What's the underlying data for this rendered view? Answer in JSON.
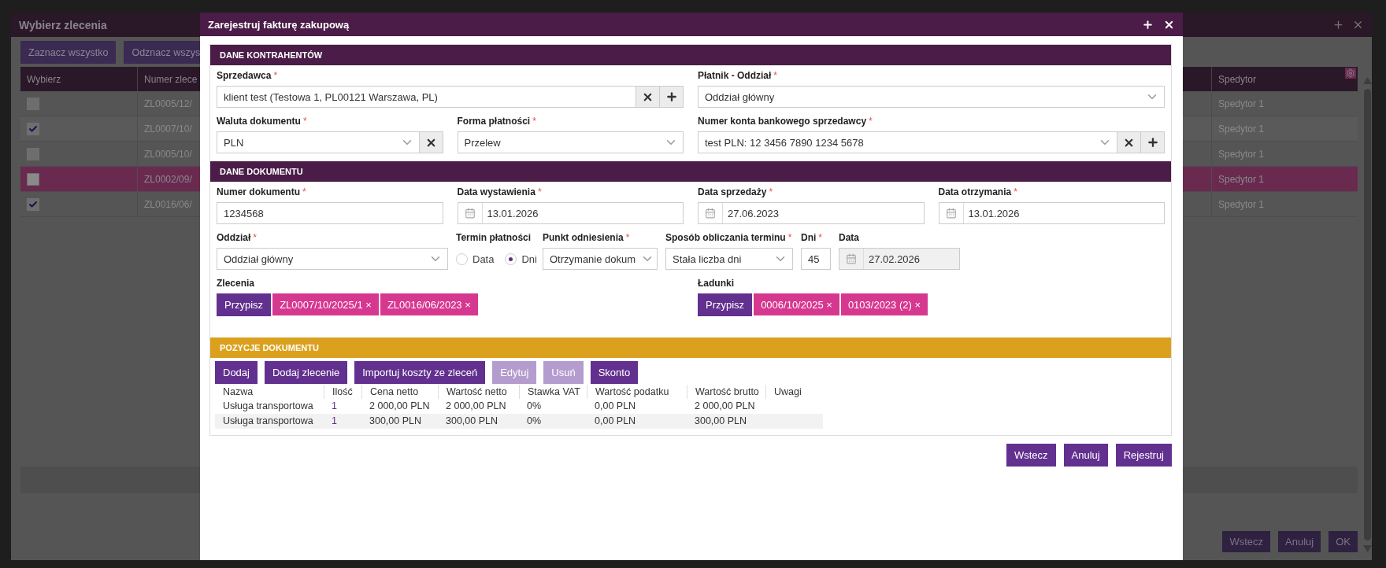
{
  "background_window": {
    "title": "Wybierz zlecenia",
    "buttons": [
      "Zaznacz wszystko",
      "Odznacz wszys"
    ],
    "columns": [
      "Wybierz",
      "Numer zlece",
      "Spedytor"
    ],
    "rows": [
      {
        "checked": false,
        "selected": false,
        "number": "ZL0005/12/",
        "forwarder": "Spedytor 1"
      },
      {
        "checked": true,
        "selected": false,
        "number": "ZL0007/10/",
        "forwarder": "Spedytor 1"
      },
      {
        "checked": false,
        "selected": false,
        "number": "ZL0005/10/",
        "forwarder": "Spedytor 1"
      },
      {
        "checked": false,
        "selected": true,
        "number": "ZL0002/09/",
        "forwarder": "Spedytor 1"
      },
      {
        "checked": true,
        "selected": false,
        "number": "ZL0016/06/",
        "forwarder": "Spedytor 1"
      }
    ],
    "footer_buttons": [
      "Wstecz",
      "Anuluj",
      "OK"
    ]
  },
  "dialog": {
    "title": "Zarejestruj fakturę zakupową",
    "sections": [
      {
        "title": "DANE KONTRAHENTÓW",
        "color": "#4a1c47",
        "rows": [
          {
            "fields": [
              {
                "kind": "text",
                "label": "Sprzedawca",
                "asterisk": "*",
                "value": "klient test (Testowa 1, PL00121 Warszawa, PL)",
                "clearable": true,
                "addable": true
              },
              {
                "kind": "select",
                "label": "Płatnik - Oddział",
                "asterisk": "*",
                "value": "Oddział główny"
              }
            ]
          },
          {
            "fields": [
              {
                "kind": "select",
                "label": "Waluta dokumentu",
                "asterisk": "*",
                "value": "PLN",
                "clearable": true
              },
              {
                "kind": "select",
                "label": "Forma płatności",
                "asterisk": "*",
                "value": "Przelew"
              },
              {
                "kind": "select",
                "label": "Numer konta bankowego sprzedawcy",
                "asterisk": "*",
                "value": "test PLN: 12 3456 7890 1234 5678",
                "clearable": true,
                "addable": true
              }
            ]
          }
        ]
      },
      {
        "title": "DANE DOKUMENTU",
        "color": "#4a1c47",
        "rows": [
          {
            "fields": [
              {
                "kind": "text",
                "label": "Numer dokumentu",
                "asterisk": "*",
                "value": "1234568"
              },
              {
                "kind": "date",
                "label": "Data wystawienia",
                "asterisk": "*",
                "value": "13.01.2026"
              },
              {
                "kind": "date",
                "label": "Data sprzedaży",
                "asterisk": "*",
                "value": "27.06.2023"
              },
              {
                "kind": "date",
                "label": "Data otrzymania",
                "asterisk": "*",
                "value": "13.01.2026"
              }
            ]
          },
          {
            "fields": [
              {
                "kind": "select",
                "label": "Oddział",
                "asterisk": "*",
                "value": "Oddział główny"
              },
              {
                "kind": "radio",
                "label": "Termin płatności",
                "options": [
                  {
                    "label": "Data",
                    "selected": false
                  },
                  {
                    "label": "Dni",
                    "selected": true
                  }
                ]
              },
              {
                "kind": "select",
                "label": "Punkt odniesienia",
                "asterisk": "*",
                "value": "Otrzymanie dokum"
              },
              {
                "kind": "select",
                "label": "Sposób obliczania terminu",
                "asterisk": "*",
                "value": "Stała liczba dni"
              },
              {
                "kind": "text",
                "label": "Dni",
                "asterisk": "*",
                "value": "45"
              },
              {
                "kind": "date",
                "label": "Data",
                "value": "27.02.2026",
                "disabled": true
              }
            ]
          },
          {
            "fields": [
              {
                "kind": "tags",
                "label": "Zlecenia",
                "button": "Przypisz",
                "tags": [
                  {
                    "label": "ZL0007/10/2025/1",
                    "remove": "×"
                  },
                  {
                    "label": "ZL0016/06/2023",
                    "remove": "×"
                  }
                ]
              },
              {
                "kind": "tags",
                "label": "Ładunki",
                "button": "Przypisz",
                "tags": [
                  {
                    "label": "0006/10/2025",
                    "remove": "×"
                  },
                  {
                    "label": "0103/2023 (2)",
                    "remove": "×"
                  }
                ]
              }
            ]
          }
        ]
      },
      {
        "title": "POZYCJE DOKUMENTU",
        "color": "#dba11e",
        "buttons": [
          {
            "label": "Dodaj",
            "disabled": false
          },
          {
            "label": "Dodaj zlecenie",
            "disabled": false
          },
          {
            "label": "Importuj koszty ze zleceń",
            "disabled": false
          },
          {
            "label": "Edytuj",
            "disabled": true
          },
          {
            "label": "Usuń",
            "disabled": true
          },
          {
            "label": "Skonto",
            "disabled": false
          }
        ],
        "table": {
          "columns": [
            "Nazwa",
            "Ilość",
            "Cena netto",
            "Wartość netto",
            "Stawka VAT",
            "Wartość podatku",
            "Wartość brutto",
            "Uwagi"
          ],
          "rows": [
            [
              "Usługa transportowa",
              "1",
              "2 000,00 PLN",
              "2 000,00 PLN",
              "0%",
              "0,00 PLN",
              "2 000,00 PLN"
            ],
            [
              "Usługa transportowa",
              "1",
              "300,00 PLN",
              "300,00 PLN",
              "0%",
              "0,00 PLN",
              "300,00 PLN"
            ]
          ]
        }
      }
    ],
    "footer_buttons": [
      "Wstecz",
      "Anuluj",
      "Rejestruj"
    ]
  }
}
